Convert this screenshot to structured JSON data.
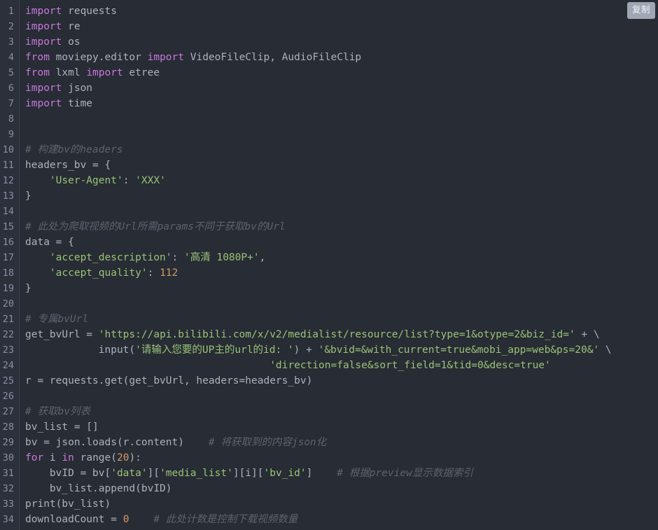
{
  "editor": {
    "language": "python",
    "theme_background": "#282c34",
    "gutter_background": "#2b303b",
    "colors": {
      "keyword": "#c678dd",
      "string": "#98c379",
      "number": "#d19a66",
      "comment": "#5c6370",
      "plain": "#abb2bf",
      "line_number": "#8a8fa3"
    }
  },
  "toolbar": {
    "copy_label": "复制"
  },
  "lines": [
    {
      "n": "1",
      "tokens": [
        {
          "t": "kw",
          "v": "import"
        },
        {
          "t": "pln",
          "v": " requests"
        }
      ]
    },
    {
      "n": "2",
      "tokens": [
        {
          "t": "kw",
          "v": "import"
        },
        {
          "t": "pln",
          "v": " re"
        }
      ]
    },
    {
      "n": "3",
      "tokens": [
        {
          "t": "kw",
          "v": "import"
        },
        {
          "t": "pln",
          "v": " os"
        }
      ]
    },
    {
      "n": "4",
      "tokens": [
        {
          "t": "kw",
          "v": "from"
        },
        {
          "t": "pln",
          "v": " moviepy.editor "
        },
        {
          "t": "kw",
          "v": "import"
        },
        {
          "t": "pln",
          "v": " VideoFileClip, AudioFileClip"
        }
      ]
    },
    {
      "n": "5",
      "tokens": [
        {
          "t": "kw",
          "v": "from"
        },
        {
          "t": "pln",
          "v": " lxml "
        },
        {
          "t": "kw",
          "v": "import"
        },
        {
          "t": "pln",
          "v": " etree"
        }
      ]
    },
    {
      "n": "6",
      "tokens": [
        {
          "t": "kw",
          "v": "import"
        },
        {
          "t": "pln",
          "v": " json"
        }
      ]
    },
    {
      "n": "7",
      "tokens": [
        {
          "t": "kw",
          "v": "import"
        },
        {
          "t": "pln",
          "v": " time"
        }
      ]
    },
    {
      "n": "8",
      "tokens": []
    },
    {
      "n": "9",
      "tokens": []
    },
    {
      "n": "10",
      "tokens": [
        {
          "t": "cmt",
          "v": "# 构建bv的headers"
        }
      ]
    },
    {
      "n": "11",
      "tokens": [
        {
          "t": "pln",
          "v": "headers_bv = {"
        }
      ]
    },
    {
      "n": "12",
      "tokens": [
        {
          "t": "pln",
          "v": "    "
        },
        {
          "t": "str",
          "v": "'User-Agent'"
        },
        {
          "t": "pln",
          "v": ": "
        },
        {
          "t": "str",
          "v": "'XXX'"
        }
      ]
    },
    {
      "n": "13",
      "tokens": [
        {
          "t": "pln",
          "v": "}"
        }
      ]
    },
    {
      "n": "14",
      "tokens": []
    },
    {
      "n": "15",
      "tokens": [
        {
          "t": "cmt",
          "v": "# 此处为爬取视频的Url所需params不同于获取bv的Url"
        }
      ]
    },
    {
      "n": "16",
      "tokens": [
        {
          "t": "pln",
          "v": "data = {"
        }
      ]
    },
    {
      "n": "17",
      "tokens": [
        {
          "t": "pln",
          "v": "    "
        },
        {
          "t": "str",
          "v": "'accept_description'"
        },
        {
          "t": "pln",
          "v": ": "
        },
        {
          "t": "str",
          "v": "'高清 1080P+'"
        },
        {
          "t": "pln",
          "v": ","
        }
      ]
    },
    {
      "n": "18",
      "tokens": [
        {
          "t": "pln",
          "v": "    "
        },
        {
          "t": "str",
          "v": "'accept_quality'"
        },
        {
          "t": "pln",
          "v": ": "
        },
        {
          "t": "num",
          "v": "112"
        }
      ]
    },
    {
      "n": "19",
      "tokens": [
        {
          "t": "pln",
          "v": "}"
        }
      ]
    },
    {
      "n": "20",
      "tokens": []
    },
    {
      "n": "21",
      "tokens": [
        {
          "t": "cmt",
          "v": "# 专属bvUrl"
        }
      ]
    },
    {
      "n": "22",
      "tokens": [
        {
          "t": "pln",
          "v": "get_bvUrl = "
        },
        {
          "t": "str",
          "v": "'https://api.bilibili.com/x/v2/medialist/resource/list?type=1&otype=2&biz_id='"
        },
        {
          "t": "pln",
          "v": " + \\"
        }
      ]
    },
    {
      "n": "23",
      "tokens": [
        {
          "t": "pln",
          "v": "            input("
        },
        {
          "t": "str",
          "v": "'请输入您要的UP主的url的id: '"
        },
        {
          "t": "pln",
          "v": ") + "
        },
        {
          "t": "str",
          "v": "'&bvid=&with_current=true&mobi_app=web&ps=20&'"
        },
        {
          "t": "pln",
          "v": " \\"
        }
      ]
    },
    {
      "n": "24",
      "tokens": [
        {
          "t": "pln",
          "v": "                                        "
        },
        {
          "t": "str",
          "v": "'direction=false&sort_field=1&tid=0&desc=true'"
        }
      ]
    },
    {
      "n": "25",
      "tokens": [
        {
          "t": "pln",
          "v": "r = requests.get(get_bvUrl, headers=headers_bv)"
        }
      ]
    },
    {
      "n": "26",
      "tokens": []
    },
    {
      "n": "27",
      "tokens": [
        {
          "t": "cmt",
          "v": "# 获取bv列表"
        }
      ]
    },
    {
      "n": "28",
      "tokens": [
        {
          "t": "pln",
          "v": "bv_list = []"
        }
      ]
    },
    {
      "n": "29",
      "tokens": [
        {
          "t": "pln",
          "v": "bv = json.loads(r.content)    "
        },
        {
          "t": "cmt",
          "v": "# 将获取到的内容json化"
        }
      ]
    },
    {
      "n": "30",
      "tokens": [
        {
          "t": "kw",
          "v": "for"
        },
        {
          "t": "pln",
          "v": " i "
        },
        {
          "t": "kw",
          "v": "in"
        },
        {
          "t": "pln",
          "v": " range("
        },
        {
          "t": "num",
          "v": "20"
        },
        {
          "t": "pln",
          "v": "):"
        }
      ]
    },
    {
      "n": "31",
      "tokens": [
        {
          "t": "pln",
          "v": "    bvID = bv["
        },
        {
          "t": "str",
          "v": "'data'"
        },
        {
          "t": "pln",
          "v": "]["
        },
        {
          "t": "str",
          "v": "'media_list'"
        },
        {
          "t": "pln",
          "v": "][i]["
        },
        {
          "t": "str",
          "v": "'bv_id'"
        },
        {
          "t": "pln",
          "v": "]    "
        },
        {
          "t": "cmt",
          "v": "# 根据preview显示数据索引"
        }
      ]
    },
    {
      "n": "32",
      "tokens": [
        {
          "t": "pln",
          "v": "    bv_list.append(bvID)"
        }
      ]
    },
    {
      "n": "33",
      "tokens": [
        {
          "t": "pln",
          "v": "print(bv_list)"
        }
      ]
    },
    {
      "n": "34",
      "tokens": [
        {
          "t": "pln",
          "v": "downloadCount = "
        },
        {
          "t": "num",
          "v": "0"
        },
        {
          "t": "pln",
          "v": "    "
        },
        {
          "t": "cmt",
          "v": "# 此处计数是控制下载视频数量"
        }
      ]
    }
  ]
}
